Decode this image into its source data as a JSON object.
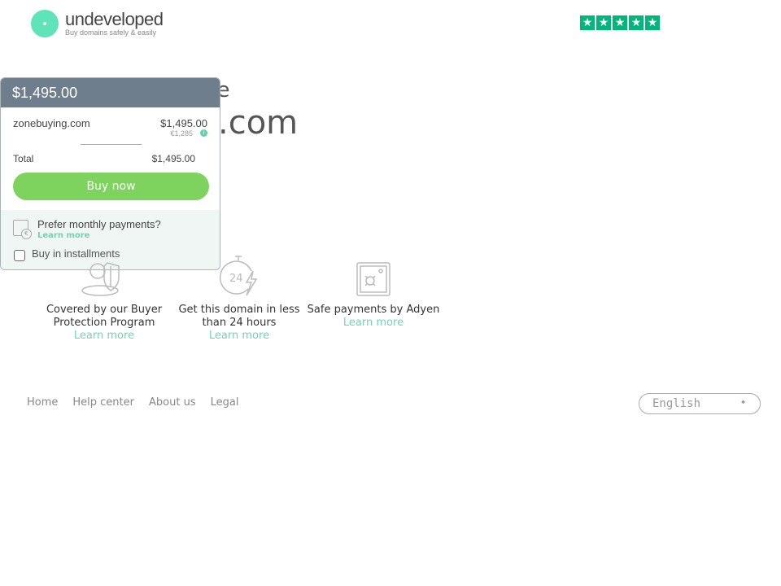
{
  "header": {
    "brand": "undeveloped",
    "tagline": "Buy domains safely & easily",
    "rating_stars": 5,
    "star_color": "#00b67a"
  },
  "headline": {
    "line1_visible": "ne",
    "line2_visible": ".com"
  },
  "panel": {
    "price": "$1,495.00",
    "domain": "zonebuying.com",
    "domain_price": "$1,495.00",
    "domain_price_eur": "€1,285",
    "total_label": "Total",
    "total": "$1,495.00",
    "buy_label": "Buy now",
    "monthly_text": "Prefer monthly payments?",
    "monthly_link": "Learn more",
    "installments_label": "Buy in installments",
    "installments_checked": false
  },
  "features": [
    {
      "icon": "shield-person-icon",
      "text": "Covered by our Buyer Protection Program",
      "link": "Learn more"
    },
    {
      "icon": "stopwatch-24-icon",
      "text": "Get this domain in less than 24 hours",
      "link": "Learn more"
    },
    {
      "icon": "safe-icon",
      "text": "Safe payments by Adyen",
      "link": "Learn more"
    }
  ],
  "footer": {
    "links": [
      "Home",
      "Help center",
      "About us",
      "Legal"
    ],
    "language": "English"
  },
  "colors": {
    "accent": "#6fd6b0",
    "buy": "#7ed35f",
    "panel_header": "#6e7e8c"
  }
}
